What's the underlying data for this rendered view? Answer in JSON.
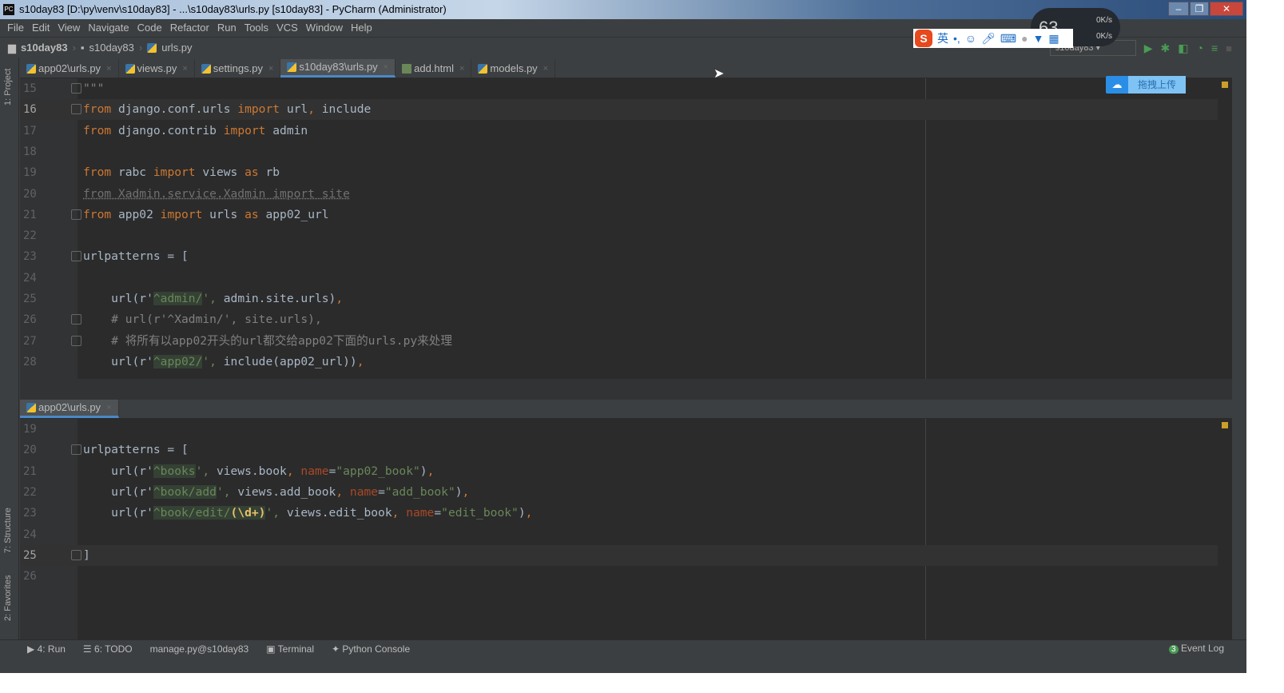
{
  "window": {
    "title": "s10day83 [D:\\py\\venv\\s10day83] - ...\\s10day83\\urls.py [s10day83] - PyCharm (Administrator)",
    "app_icon": "PC"
  },
  "menu": [
    "File",
    "Edit",
    "View",
    "Navigate",
    "Code",
    "Refactor",
    "Run",
    "Tools",
    "VCS",
    "Window",
    "Help"
  ],
  "breadcrumb": [
    "s10day83",
    "s10day83",
    "urls.py"
  ],
  "run_config": "s10day83",
  "tabs": [
    {
      "label": "app02\\urls.py",
      "icon": "python-file-icon"
    },
    {
      "label": "views.py",
      "icon": "python-file-icon"
    },
    {
      "label": "settings.py",
      "icon": "python-file-icon"
    },
    {
      "label": "s10day83\\urls.py",
      "icon": "python-file-icon",
      "active": true
    },
    {
      "label": "add.html",
      "icon": "html-file-icon"
    },
    {
      "label": "models.py",
      "icon": "python-file-icon"
    }
  ],
  "side_tools": {
    "project": "1: Project",
    "structure": "7: Structure",
    "favorites": "2: Favorites"
  },
  "top_editor": {
    "lines": [
      {
        "n": "15",
        "t": [
          [
            "\"\"\"",
            "cm"
          ]
        ]
      },
      {
        "n": "16",
        "cur": true,
        "t": [
          [
            "from",
            "kw"
          ],
          [
            " django.conf.urls ",
            "id"
          ],
          [
            "import",
            "kw"
          ],
          [
            " url",
            "id"
          ],
          [
            ",",
            "kw"
          ],
          [
            " include",
            "id"
          ]
        ]
      },
      {
        "n": "17",
        "t": [
          [
            "from",
            "kw"
          ],
          [
            " django.contrib ",
            "id"
          ],
          [
            "import",
            "kw"
          ],
          [
            " admin",
            "id"
          ]
        ]
      },
      {
        "n": "18",
        "t": []
      },
      {
        "n": "19",
        "t": [
          [
            "from",
            "kw"
          ],
          [
            " rabc ",
            "id"
          ],
          [
            "import",
            "kw"
          ],
          [
            " views ",
            "id"
          ],
          [
            "as",
            "kw"
          ],
          [
            " rb",
            "id"
          ]
        ]
      },
      {
        "n": "20",
        "t": [
          [
            "from Xadmin.service.Xadmin import site",
            "unused"
          ]
        ]
      },
      {
        "n": "21",
        "t": [
          [
            "from",
            "kw"
          ],
          [
            " app02 ",
            "id"
          ],
          [
            "import",
            "kw"
          ],
          [
            " urls ",
            "id"
          ],
          [
            "as",
            "kw"
          ],
          [
            " app02_url",
            "id"
          ]
        ]
      },
      {
        "n": "22",
        "t": []
      },
      {
        "n": "23",
        "t": [
          [
            "urlpatterns = [",
            "id"
          ]
        ]
      },
      {
        "n": "24",
        "t": []
      },
      {
        "n": "25",
        "t": [
          [
            "    url(r'",
            "id"
          ],
          [
            "^admin/",
            "strbg"
          ],
          [
            "', ",
            "str"
          ],
          [
            "admin.site.urls)",
            "id"
          ],
          [
            ",",
            "kw"
          ]
        ]
      },
      {
        "n": "26",
        "t": [
          [
            "    # url(r'^Xadmin/', site.urls),",
            "cm"
          ]
        ]
      },
      {
        "n": "27",
        "t": [
          [
            "    # 将所有以app02开头的url都交给app02下面的urls.py来处理",
            "cm"
          ]
        ]
      },
      {
        "n": "28",
        "t": [
          [
            "    url(r'",
            "id"
          ],
          [
            "^app02/",
            "strbg"
          ],
          [
            "', ",
            "str"
          ],
          [
            "include(app02_url))",
            "id"
          ],
          [
            ",",
            "kw"
          ]
        ]
      }
    ]
  },
  "bottom_tab": {
    "label": "app02\\urls.py",
    "icon": "python-file-icon"
  },
  "bottom_editor": {
    "lines": [
      {
        "n": "19",
        "t": []
      },
      {
        "n": "20",
        "t": [
          [
            "urlpatterns = [",
            "id"
          ]
        ]
      },
      {
        "n": "21",
        "t": [
          [
            "    url(r'",
            "id"
          ],
          [
            "^books",
            "strbg"
          ],
          [
            "', ",
            "str"
          ],
          [
            "views.book",
            "id"
          ],
          [
            ", ",
            "kw"
          ],
          [
            "name",
            "prm"
          ],
          [
            "=",
            "id"
          ],
          [
            "\"app02_book\"",
            "str"
          ],
          [
            ")",
            "id"
          ],
          [
            ",",
            "kw"
          ]
        ]
      },
      {
        "n": "22",
        "t": [
          [
            "    url(r'",
            "id"
          ],
          [
            "^book/add",
            "strbg"
          ],
          [
            "', ",
            "str"
          ],
          [
            "views.add_book",
            "id"
          ],
          [
            ", ",
            "kw"
          ],
          [
            "name",
            "prm"
          ],
          [
            "=",
            "id"
          ],
          [
            "\"add_book\"",
            "str"
          ],
          [
            ")",
            "id"
          ],
          [
            ",",
            "kw"
          ]
        ]
      },
      {
        "n": "23",
        "t": [
          [
            "    url(r'",
            "id"
          ],
          [
            "^book/edit/",
            "strbg"
          ],
          [
            "(\\d+)",
            "esc"
          ],
          [
            "', ",
            "str"
          ],
          [
            "views.edit_book",
            "id"
          ],
          [
            ", ",
            "kw"
          ],
          [
            "name",
            "prm"
          ],
          [
            "=",
            "id"
          ],
          [
            "\"edit_book\"",
            "str"
          ],
          [
            ")",
            "id"
          ],
          [
            ",",
            "kw"
          ]
        ]
      },
      {
        "n": "24",
        "t": []
      },
      {
        "n": "25",
        "cur": true,
        "t": [
          [
            "]",
            "id"
          ]
        ]
      },
      {
        "n": "26",
        "t": []
      }
    ]
  },
  "toolwindows": [
    "4: Run",
    "6: TODO",
    "manage.py@s10day83",
    "Terminal",
    "Python Console"
  ],
  "event_log": {
    "label": "Event Log",
    "count": "3"
  },
  "overlays": {
    "ime_lang": "英",
    "net_value": "63",
    "up": "0K/s",
    "down": "0K/s",
    "upload_label": "拖拽上传"
  },
  "colors": {
    "keyword": "#cc7832",
    "string": "#6a8759",
    "comment": "#808080",
    "param": "#aa4926",
    "bg": "#2b2b2b"
  }
}
